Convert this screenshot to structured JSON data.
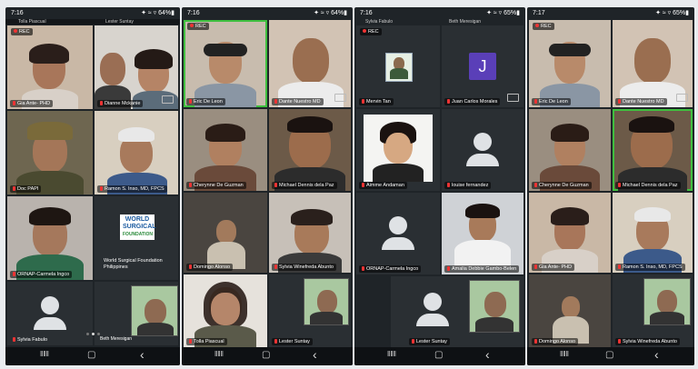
{
  "phones": [
    {
      "time": "7:16",
      "status_right": "✦ ≈ ▿ 64%▮",
      "rec_label": "REC",
      "top_names": [
        "Tolla Piascual",
        "Lester Suntay"
      ],
      "tiles": [
        {
          "name": "Gia Ante- PHD"
        },
        {
          "name": "Dianne Mckanie"
        },
        {
          "name": "Doc PAPI"
        },
        {
          "name": "Ramon S. Inso, MD, FPCS"
        },
        {
          "name": "ORNAP-Carmela Ingco"
        },
        {
          "name": "World Surgical Foundation Philippines"
        },
        {
          "name": "Sylvia Fabulo"
        },
        {
          "name": "Beth Meresigan"
        }
      ],
      "logo": {
        "line1": "WORLD SURGICAL",
        "line2": "FOUNDATION"
      }
    },
    {
      "time": "7:16",
      "status_right": "✦ ≈ ▿ 64%▮",
      "rec_label": "REC",
      "tiles": [
        {
          "name": "Eric De Leon"
        },
        {
          "name": "Dante Nuestro MD"
        },
        {
          "name": "Cherynne De Guzman"
        },
        {
          "name": "Michael Dennis dela Paz"
        },
        {
          "name": "Domingo Alonso"
        },
        {
          "name": "Sylvia Winefreda Abunto"
        },
        {
          "name": "Tolla Piascual"
        },
        {
          "name": "Lester Suntay"
        }
      ]
    },
    {
      "time": "7:16",
      "status_right": "✦ ≈ ▿ 65%▮",
      "rec_label": "REC",
      "top_names": [
        "Sylvia Fabulo",
        "Beth Meresigan"
      ],
      "tiles": [
        {
          "name": "Mervin Tan"
        },
        {
          "name": "Juan Carlos Morales",
          "initial": "J"
        },
        {
          "name": "Aimme Andaman"
        },
        {
          "name": "louise fernandez"
        },
        {
          "name": "ORNAP-Carmela Ingco"
        },
        {
          "name": "Amalia Debbie Gambo-Belen"
        },
        {
          "name": "Lester Suntay"
        }
      ]
    },
    {
      "time": "7:17",
      "status_right": "✦ ≈ ▿ 65%▮",
      "rec_label": "REC",
      "tiles": [
        {
          "name": "Eric De Leon"
        },
        {
          "name": "Dante Nuestro MD"
        },
        {
          "name": "Cherynne De Guzman"
        },
        {
          "name": "Michael Dennis dela Paz"
        },
        {
          "name": "Gia Ante- PHD"
        },
        {
          "name": "Ramon S. Inso, MD, FPCS"
        },
        {
          "name": "Domingo Alonso"
        },
        {
          "name": "Sylvia Winefreda Abunto"
        }
      ]
    }
  ],
  "nav": {
    "recents": "‖‖‖",
    "home": "▢",
    "back": "‹"
  },
  "colors": {
    "active_border": "#3fbf3f",
    "rec_dot": "#e33333",
    "bg": "#1f2428"
  }
}
